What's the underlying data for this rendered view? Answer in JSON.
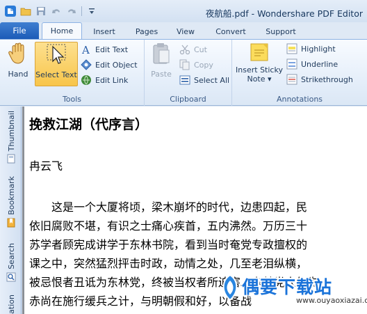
{
  "window": {
    "title": "夜航船.pdf - Wondershare PDF Editor"
  },
  "tabs": {
    "file": "File",
    "items": [
      "Home",
      "Insert",
      "Pages",
      "View",
      "Convert",
      "Support"
    ],
    "active": "Home"
  },
  "ribbon": {
    "tools": {
      "hand": "Hand",
      "select_text": "Select Text",
      "edit_text": "Edit Text",
      "edit_object": "Edit Object",
      "edit_link": "Edit Link",
      "label": "Tools"
    },
    "clipboard": {
      "paste": "Paste",
      "cut": "Cut",
      "copy": "Copy",
      "select_all": "Select All",
      "label": "Clipboard"
    },
    "annotations": {
      "insert_sticky_line1": "Insert Sticky",
      "insert_sticky_line2": "Note ▾",
      "highlight": "Highlight",
      "underline": "Underline",
      "strikethrough": "Strikethrough",
      "label": "Annotations"
    }
  },
  "sidepanel": {
    "thumbnail": "Thumbnail",
    "bookmark": "Bookmark",
    "search": "Search",
    "annotation": "ation"
  },
  "document": {
    "heading": "挽救江湖（代序言）",
    "author": "冉云飞",
    "lines": [
      "　　这是一个大厦将顷，梁木崩坏的时代，边患四起，民",
      "依旧腐败不堪，有识之士痛心疾首，五内沸然。万历三十",
      "苏学者顾宪成讲学于东林书院，看到当时奄党专政擅权的",
      "课之中，突然猛烈抨击时政，动情之处，几至老泪纵横，",
      "被忌恨者丑诋为东林党，终被当权者所迫害。东林党人的先",
      "赤尚在施行缓兵之计，与明朝假和好，以备战"
    ]
  },
  "watermark": {
    "text": "偶要下载站",
    "url": "www.ouyaoxiazai.com"
  },
  "colors": {
    "file_tab": "#1c5bb7",
    "selected_button": "#f8c54a",
    "watermark": "#1a73d9"
  }
}
